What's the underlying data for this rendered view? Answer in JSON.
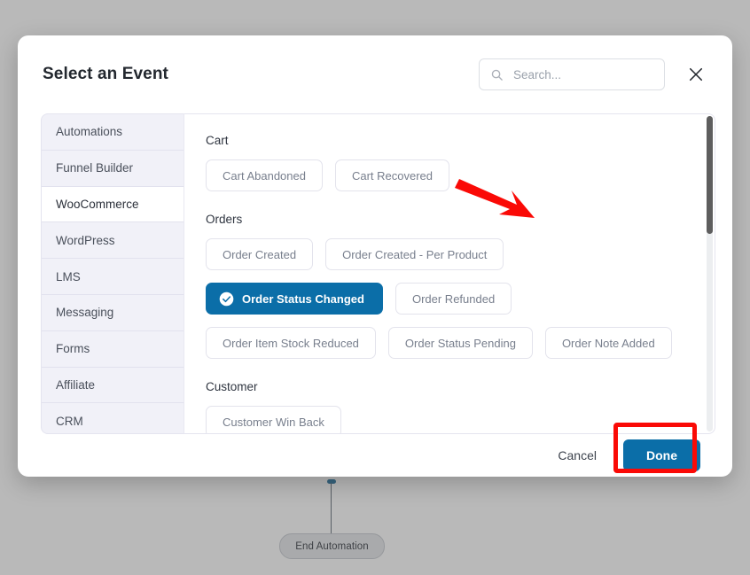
{
  "background": {
    "end_automation_label": "End Automation"
  },
  "modal": {
    "title": "Select an Event",
    "search": {
      "placeholder": "Search...",
      "value": "",
      "icon": "search-icon"
    },
    "close_icon": "close-icon",
    "sidebar": {
      "items": [
        {
          "label": "Automations",
          "active": false
        },
        {
          "label": "Funnel Builder",
          "active": false
        },
        {
          "label": "WooCommerce",
          "active": true
        },
        {
          "label": "WordPress",
          "active": false
        },
        {
          "label": "LMS",
          "active": false
        },
        {
          "label": "Messaging",
          "active": false
        },
        {
          "label": "Forms",
          "active": false
        },
        {
          "label": "Affiliate",
          "active": false
        },
        {
          "label": "CRM",
          "active": false
        }
      ]
    },
    "groups": [
      {
        "title": "Cart",
        "events": [
          {
            "label": "Cart Abandoned",
            "selected": false
          },
          {
            "label": "Cart Recovered",
            "selected": false
          }
        ]
      },
      {
        "title": "Orders",
        "events": [
          {
            "label": "Order Created",
            "selected": false
          },
          {
            "label": "Order Created - Per Product",
            "selected": false
          },
          {
            "label": "Order Status Changed",
            "selected": true
          },
          {
            "label": "Order Refunded",
            "selected": false
          },
          {
            "label": "Order Item Stock Reduced",
            "selected": false
          },
          {
            "label": "Order Status Pending",
            "selected": false
          },
          {
            "label": "Order Note Added",
            "selected": false
          }
        ]
      },
      {
        "title": "Customer",
        "events": [
          {
            "label": "Customer Win Back",
            "selected": false
          }
        ]
      }
    ],
    "footer": {
      "cancel_label": "Cancel",
      "done_label": "Done"
    }
  },
  "colors": {
    "accent_blue": "#0b6ea8",
    "annotation_red": "#fa0a06",
    "sidebar_bg": "#f1f1f8",
    "chip_border": "#e3e3ec",
    "scrollbar_thumb": "#5e5e5e"
  }
}
